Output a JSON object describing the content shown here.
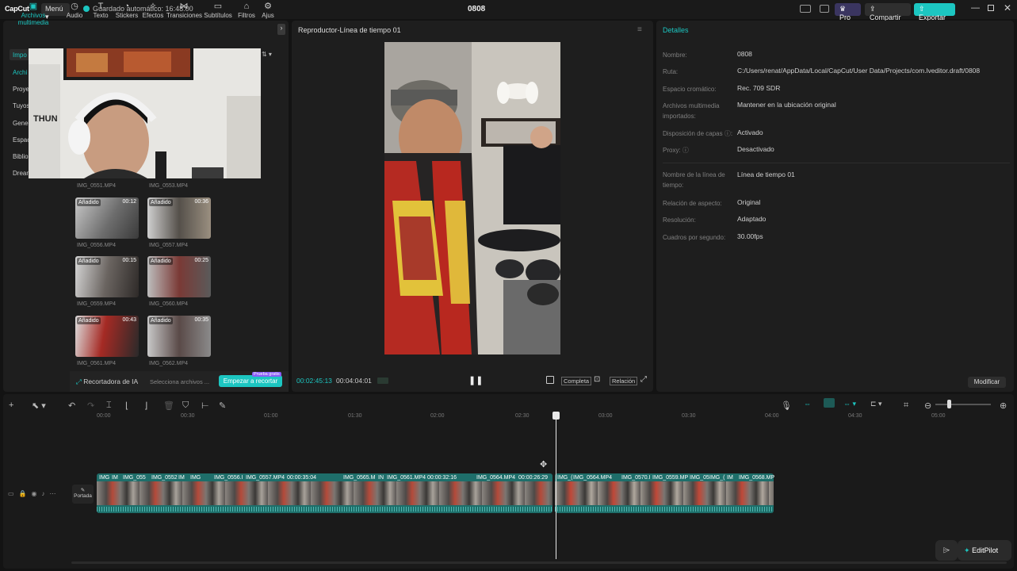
{
  "app": {
    "logo": "CapCut",
    "menu_label": "Menú",
    "autosave_text": "Guardado automático: 16:48:00",
    "project_title": "0808",
    "pro_label": "Pro",
    "share_label": "Compartir",
    "export_label": "Exportar"
  },
  "toolbar": {
    "tabs": [
      {
        "label": "Archivos multimedia",
        "icon": "media-icon"
      },
      {
        "label": "Audio",
        "icon": "audio-icon"
      },
      {
        "label": "Texto",
        "icon": "text-icon"
      },
      {
        "label": "Stickers",
        "icon": "sticker-icon"
      },
      {
        "label": "Efectos",
        "icon": "effects-icon"
      },
      {
        "label": "Transiciones",
        "icon": "transition-icon"
      },
      {
        "label": "Subtítulos",
        "icon": "subtitle-icon"
      },
      {
        "label": "Filtros",
        "icon": "filter-icon"
      },
      {
        "label": "Ajus",
        "icon": "adjust-icon"
      }
    ]
  },
  "media": {
    "sidebar": [
      "Impo",
      "Archi",
      "Proye",
      "Tuyos",
      "Gener",
      "Espac",
      "Biblio",
      "Dream"
    ],
    "added_label": "Añadido",
    "items": [
      {
        "name": "IMG_0551.MP4",
        "duration": "",
        "added": false
      },
      {
        "name": "IMG_0553.MP4",
        "duration": "",
        "added": false
      },
      {
        "name": "IMG_0556.MP4",
        "duration": "00:12",
        "added": true
      },
      {
        "name": "IMG_0557.MP4",
        "duration": "00:36",
        "added": true
      },
      {
        "name": "IMG_0559.MP4",
        "duration": "00:15",
        "added": true
      },
      {
        "name": "IMG_0560.MP4",
        "duration": "00:25",
        "added": true
      },
      {
        "name": "IMG_0561.MP4",
        "duration": "00:43",
        "added": true
      },
      {
        "name": "IMG_0562.MP4",
        "duration": "00:35",
        "added": true
      }
    ],
    "cropper_label": "Recortadora de IA",
    "cropper_select": "Selecciona archivos ...",
    "cropper_button": "Empezar a recortar",
    "cropper_badge": "Prueba gratis"
  },
  "player": {
    "title": "Reproductor-Línea de tiempo 01",
    "current_time": "00:02:45:13",
    "total_time": "00:04:04:01",
    "complete_label": "Completa",
    "ratio_label": "Relación"
  },
  "details": {
    "title": "Detalles",
    "rows": [
      {
        "label": "Nombre:",
        "value": "0808"
      },
      {
        "label": "Ruta:",
        "value": "C:/Users/renat/AppData/Local/CapCut/User Data/Projects/com.lveditor.draft/0808"
      },
      {
        "label": "Espacio cromático:",
        "value": "Rec. 709 SDR"
      },
      {
        "label": "Archivos multimedia importados:",
        "value": "Mantener en la ubicación original"
      },
      {
        "label": "Disposición de capas ⓘ:",
        "value": "Activado"
      },
      {
        "label": "Proxy: ⓘ",
        "value": "Desactivado"
      },
      {
        "label": "Nombre de la línea de tiempo:",
        "value": "Línea de tiempo 01"
      },
      {
        "label": "Relación de aspecto:",
        "value": "Original"
      },
      {
        "label": "Resolución:",
        "value": "Adaptado"
      },
      {
        "label": "Cuadros por segundo:",
        "value": "30.00fps"
      }
    ],
    "modify_label": "Modificar"
  },
  "timeline": {
    "ruler": [
      "00:00",
      "00:30",
      "01:00",
      "01:30",
      "02:00",
      "02:30",
      "03:00",
      "03:30",
      "04:00",
      "04:30",
      "05:00"
    ],
    "cover_label": "Portada",
    "clip_labels": [
      "IMG",
      "IM",
      "IMG_055",
      "IMG_0552",
      "IM",
      "IMG",
      "IMG_0556.I",
      "IMG_0557.MP4",
      "00:00:35:04",
      "IMG_0565.M",
      "IN",
      "IMG_0561.MP4",
      "00:00:32:16",
      "IMG_0564.MP4",
      "00:00:26:29",
      "IMG_(",
      "IMG_0564.MP4",
      "IMG_0570.I",
      "IMG_0559.MP",
      "IMG_05",
      "IMG_(",
      "IM",
      "IMG_0568.MP"
    ],
    "editpilot_label": "EditPilot"
  },
  "colors": {
    "accent": "#1cc6c1",
    "export_bg": "#1cc6c1",
    "pro": "#6b4fd8",
    "clip": "#1e6e6a"
  }
}
